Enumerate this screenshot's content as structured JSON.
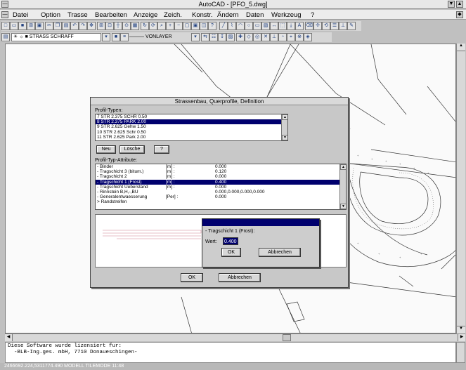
{
  "window": {
    "title": "AutoCAD - [PFO_5.dwg]"
  },
  "menu": [
    "Datei",
    "Option",
    "Trasse",
    "Bearbeiten",
    "Anzeige",
    "Zeich.",
    "Konstr.",
    "Ändern",
    "Daten",
    "Werkzeug",
    "?"
  ],
  "toolbar2": {
    "layer": "STRASS SCHRAFF",
    "linetype": "VONLAYER"
  },
  "dialog": {
    "title": "Strassenbau, Querprofile, Definition",
    "types_label": "Profil-Typen:",
    "types": [
      "7 STR 2.375 SCHR 0.50",
      "8 STR 2.375 PARK 2.00",
      "9 STR 2.625 Gehw 1.50",
      "10 STR 2.625 Schr 0.50",
      "11 STR 2.625 Park 2.00"
    ],
    "selected_type": 1,
    "buttons": {
      "new": "Neu",
      "delete": "Lösche",
      "help": "?",
      "ok": "OK",
      "cancel": "Abbrechen"
    },
    "attrs_label": "Profil-Typ-Attribute:",
    "attributes": [
      {
        "name": "- Binder",
        "unit": "[m] :",
        "value": "0.000"
      },
      {
        "name": "- Tragschicht 3 (bitum.)",
        "unit": "[m] :",
        "value": "0.120"
      },
      {
        "name": "- Tragschicht 2",
        "unit": "[m] :",
        "value": "0.000"
      },
      {
        "name": "- Tragschicht 1 (Frost)",
        "unit": "[m] :",
        "value": "0.400"
      },
      {
        "name": "- Tragschicht Ueberstand",
        "unit": "[m] :",
        "value": "0.000"
      },
      {
        "name": "- Rinnstein   B,H,-,BU",
        "unit": "",
        "value": "0.000,0.000,0.000,0.000"
      },
      {
        "name": "- Generalentwaesserung",
        "unit": "[Per] :",
        "value": "0.000"
      },
      {
        "name": "> Randstreifen",
        "unit": "",
        "value": ""
      }
    ],
    "selected_attr": 3
  },
  "subdialog": {
    "label": "- Tragschicht 1 (Frost):",
    "field_label": "Wert:",
    "value": "0.400",
    "ok": "OK",
    "cancel": "Abbrechen"
  },
  "command": {
    "line1": "Diese Software wurde lizensiert fur:",
    "line2": "  -BLB-Ing.ges. mbH, 7710 Donaueschingen-"
  },
  "status": "2466692.224,5311774.490     MODELL TILEMODE 11:48",
  "colors": {
    "selection": "#00006e",
    "canvas": "#fafafa"
  }
}
